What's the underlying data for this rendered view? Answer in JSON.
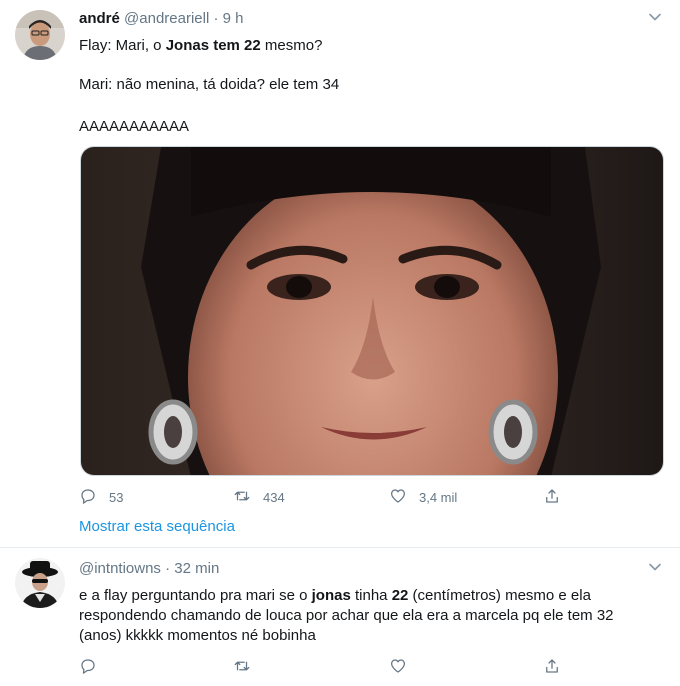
{
  "tweet1": {
    "name": "andré",
    "handle": "@andreariell",
    "dot": "·",
    "time": "9 h",
    "line1_prefix": "Flay: Mari, o ",
    "line1_bold": "Jonas tem 22",
    "line1_suffix": " mesmo?",
    "line2": "Mari: não menina, tá doida? ele tem 34",
    "line3": "AAAAAAAAAAA",
    "replies": "53",
    "retweets": "434",
    "likes": "3,4 mil",
    "show_thread": "Mostrar esta sequência"
  },
  "tweet2": {
    "handle": "@intntiowns",
    "dot": "·",
    "time": "32 min",
    "t_1": "e a flay perguntando pra mari se o ",
    "t_2": "jonas",
    "t_3": " tinha ",
    "t_4": "22",
    "t_5": " (centímetros) mesmo e ela respondendo chamando de louca por achar que ela era a marcela pq ele tem 32 (anos) kkkkk momentos né bobinha"
  },
  "icons": {
    "reply": "reply-icon",
    "retweet": "retweet-icon",
    "like": "heart-icon",
    "share": "share-icon",
    "caret": "chevron-down-icon"
  },
  "colors": {
    "link": "#1b95e0",
    "secondary_text": "#657786",
    "separator": "#e6ecf0"
  }
}
